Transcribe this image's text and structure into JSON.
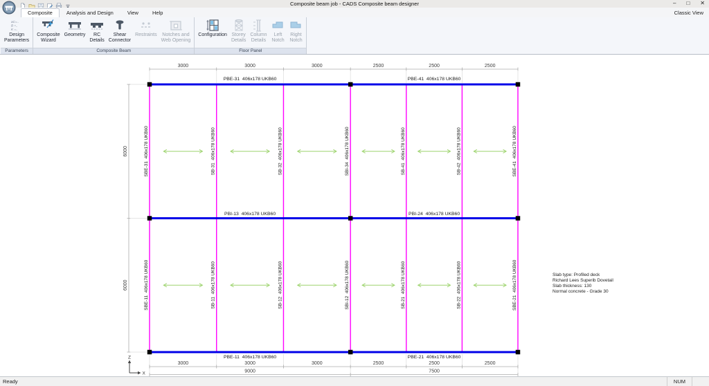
{
  "window": {
    "title": "Composite beam job - CADS Composite beam designer",
    "view_mode": "Classic View",
    "controls": [
      "–",
      "□",
      "✕"
    ],
    "status_ready": "Ready",
    "status_num": "NUM"
  },
  "qat": {
    "buttons": [
      "new-document",
      "open-folder",
      "save",
      "edit",
      "print"
    ],
    "overflow": "qat-dropdown"
  },
  "tabs": [
    {
      "label": "Composite",
      "active": true
    },
    {
      "label": "Analysis and Design",
      "active": false
    },
    {
      "label": "View",
      "active": false
    },
    {
      "label": "Help",
      "active": false
    }
  ],
  "ribbon": {
    "groups": [
      {
        "caption": "Parameters",
        "buttons": [
          {
            "icon": "design-parameters",
            "lines": [
              "Design",
              "Parameters"
            ],
            "enabled": true
          }
        ]
      },
      {
        "caption": "Composite Beam",
        "buttons": [
          {
            "icon": "composite-wizard",
            "lines": [
              "Composite",
              "Wizard"
            ],
            "enabled": true
          },
          {
            "icon": "geometry",
            "lines": [
              "Geometry"
            ],
            "enabled": true
          },
          {
            "icon": "rc-details",
            "lines": [
              "RC",
              "Details"
            ],
            "enabled": true
          },
          {
            "icon": "shear-connector",
            "lines": [
              "Shear",
              "Connector"
            ],
            "enabled": true
          },
          {
            "icon": "restraints",
            "lines": [
              "Restraints"
            ],
            "enabled": false
          },
          {
            "icon": "notches-web-opening",
            "lines": [
              "Notches and",
              "Web Opening"
            ],
            "enabled": false
          }
        ]
      },
      {
        "caption": "Floor Panel",
        "buttons": [
          {
            "icon": "configuration",
            "lines": [
              "Configuration"
            ],
            "enabled": true
          },
          {
            "icon": "storey-details",
            "lines": [
              "Storey",
              "Details"
            ],
            "enabled": false
          },
          {
            "icon": "column-details",
            "lines": [
              "Column",
              "Details"
            ],
            "enabled": false
          },
          {
            "icon": "left-notch",
            "lines": [
              "Left",
              "Notch"
            ],
            "enabled": false
          },
          {
            "icon": "right-notch",
            "lines": [
              "Right",
              "Notch"
            ],
            "enabled": false
          }
        ]
      }
    ]
  },
  "plan": {
    "bay_widths_mm": [
      3000,
      3000,
      3000,
      2500,
      2500,
      2500
    ],
    "row_heights_mm": [
      6000,
      6000
    ],
    "top_dims": [
      "3000",
      "3000",
      "3000",
      "2500",
      "2500",
      "2500"
    ],
    "bottom_dims": [
      "3000",
      "3000",
      "3000",
      "2500",
      "2500",
      "2500"
    ],
    "overall_dims": [
      "9000",
      "7500"
    ],
    "left_dims": [
      "6000",
      "6000"
    ],
    "beam_section": "406x178 UKB60",
    "primary_beams": [
      {
        "row": "top",
        "labels": [
          "PBE-31  406x178 UKB60",
          "PBE-41  406x178 UKB60"
        ]
      },
      {
        "row": "middle",
        "labels": [
          "PBI-13  406x178 UKB60",
          "PBI-24  406x178 UKB60"
        ]
      },
      {
        "row": "bottom",
        "labels": [
          "PBE-11  406x178 UKB60",
          "PBE-21  406x178 UKB60"
        ]
      }
    ],
    "secondary_beams_top": [
      "SBE-31  406x178 UKB60",
      "SB-31  406x178 UKB60",
      "SB-32  406x178 UKB60",
      "SBI-34  406x178 UKB60",
      "SB-41  406x178 UKB60",
      "SB-42  406x178 UKB60",
      "SBE-41  406x178 UKB60"
    ],
    "secondary_beams_bottom": [
      "SBE-11  406x178 UKB60",
      "SB-11  406x178 UKB60",
      "SB-12  406x178 UKB60",
      "SBI-12  406x178 UKB60",
      "SB-21  406x178 UKB60",
      "SB-22  406x178 UKB60",
      "SBE-21  406x178 UKB60"
    ],
    "notes": [
      "Slab type: Profiled deck",
      "Richard Lees Superib Dovetail",
      "Slab thickness: 130",
      "Normal concrete - Grade 30"
    ],
    "axis_labels": {
      "vertical": "Z",
      "horizontal": "X"
    },
    "colors": {
      "primary_beam": "#0000E8",
      "secondary_beam": "#FF00FF",
      "deck_arrow": "#9ED46F",
      "node": "#000000",
      "dimension_line": "#ABABAB",
      "extension_line": "#DCDCDC",
      "dimension_text": "#3C3C3C",
      "label_text": "#1A1A1A"
    }
  }
}
